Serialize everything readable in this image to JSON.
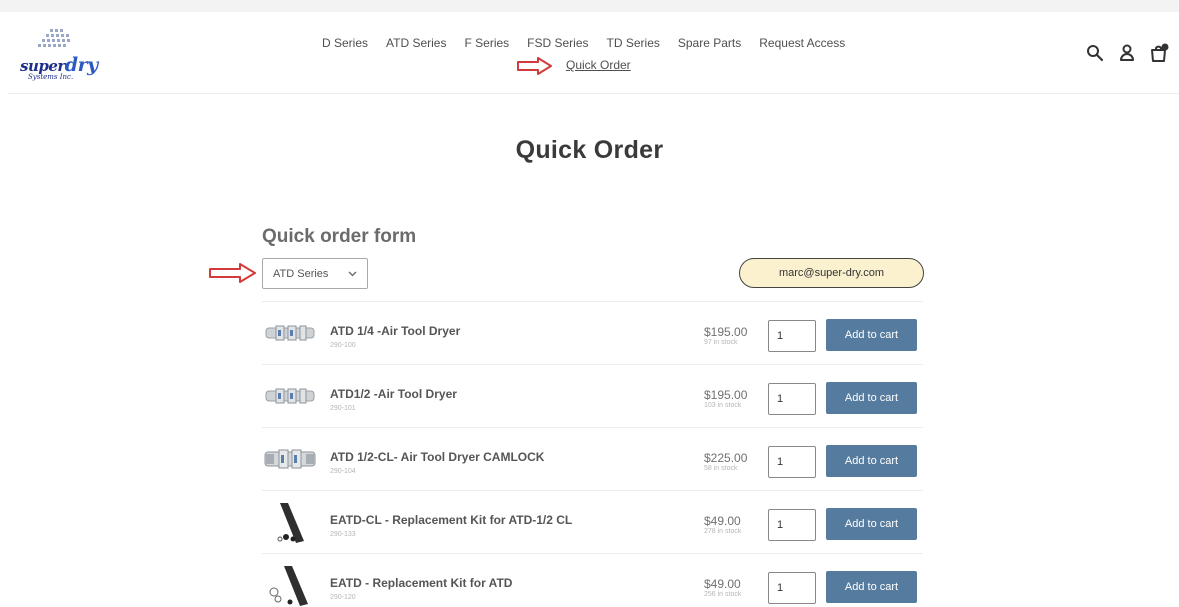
{
  "header": {
    "logo": {
      "brand_main": "super",
      "brand_accent": "dry",
      "brand_sub": "Systems Inc."
    },
    "nav": [
      "D Series",
      "ATD Series",
      "F Series",
      "FSD Series",
      "TD Series",
      "Spare Parts",
      "Request Access"
    ],
    "quick_order_link": "Quick Order",
    "icons": {
      "search": "search-icon",
      "account": "account-icon",
      "cart": "cart-icon"
    }
  },
  "page": {
    "title": "Quick Order",
    "form_title": "Quick order form",
    "series_select": {
      "selected": "ATD Series"
    },
    "email": "marc@super-dry.com"
  },
  "products": [
    {
      "name": "ATD 1/4 -Air Tool Dryer",
      "sku": "290-100",
      "price": "$195.00",
      "stock": "97 in stock",
      "qty": "1",
      "button": "Add to cart",
      "thumb": "dryer-image"
    },
    {
      "name": "ATD1/2 -Air Tool Dryer",
      "sku": "290-101",
      "price": "$195.00",
      "stock": "103 in stock",
      "qty": "1",
      "button": "Add to cart",
      "thumb": "dryer-image"
    },
    {
      "name": "ATD 1/2-CL- Air Tool Dryer CAMLOCK",
      "sku": "290-104",
      "price": "$225.00",
      "stock": "58 in stock",
      "qty": "1",
      "button": "Add to cart",
      "thumb": "camlock-dryer-image"
    },
    {
      "name": "EATD-CL - Replacement Kit for ATD-1/2 CL",
      "sku": "290-133",
      "price": "$49.00",
      "stock": "278 in stock",
      "qty": "1",
      "button": "Add to cart",
      "thumb": "replacement-kit-image"
    },
    {
      "name": "EATD - Replacement Kit for ATD",
      "sku": "290-120",
      "price": "$49.00",
      "stock": "256 in stock",
      "qty": "1",
      "button": "Add to cart",
      "thumb": "replacement-kit-image"
    }
  ],
  "colors": {
    "button": "#557b9e",
    "email_badge": "#fbf1cf",
    "annotation_arrow": "#d33a3a",
    "brand": "#1d2f8a"
  }
}
